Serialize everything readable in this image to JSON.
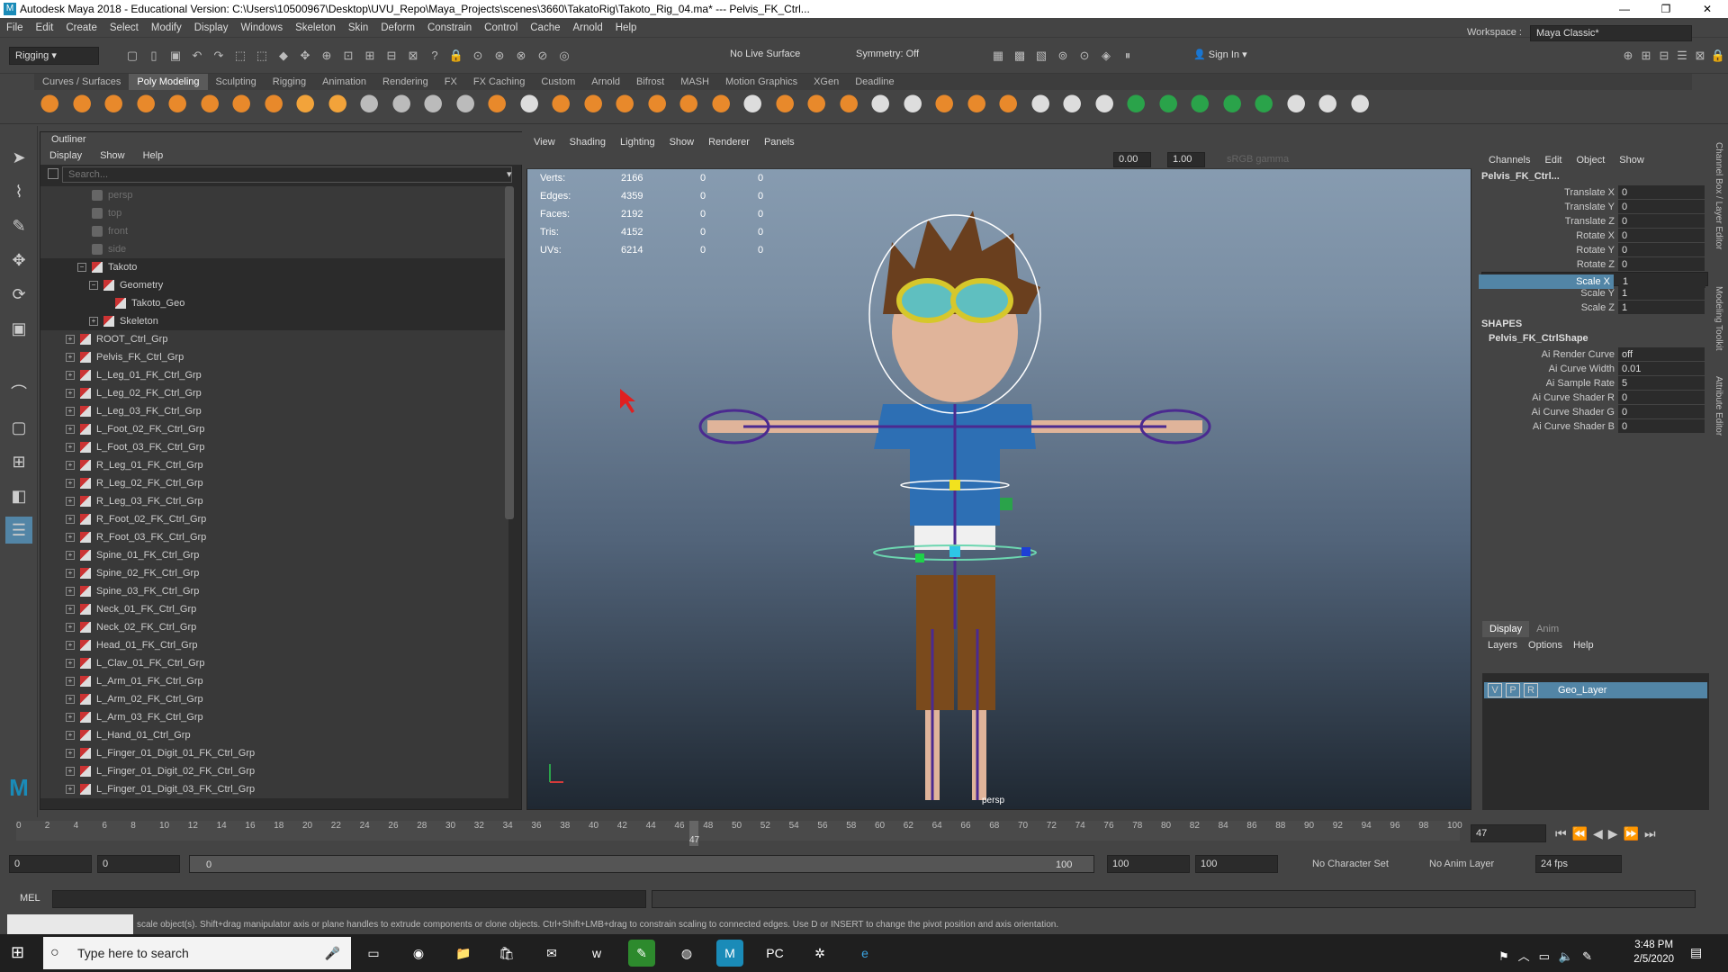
{
  "titlebar": {
    "title": "Autodesk Maya 2018 - Educational Version: C:\\Users\\10500967\\Desktop\\UVU_Repo\\Maya_Projects\\scenes\\3660\\TakatoRig\\Takoto_Rig_04.ma*   ---   Pelvis_FK_Ctrl..."
  },
  "menubar": [
    "File",
    "Edit",
    "Create",
    "Select",
    "Modify",
    "Display",
    "Windows",
    "Skeleton",
    "Skin",
    "Deform",
    "Constrain",
    "Control",
    "Cache",
    "Arnold",
    "Help"
  ],
  "toolbar": {
    "mode": "Rigging",
    "live_surface": "No Live Surface",
    "symmetry": "Symmetry: Off",
    "sign_in": "Sign In",
    "workspace_label": "Workspace :",
    "workspace": "Maya Classic*"
  },
  "shelf_tabs": [
    "Curves / Surfaces",
    "Poly Modeling",
    "Sculpting",
    "Rigging",
    "Animation",
    "Rendering",
    "FX",
    "FX Caching",
    "Custom",
    "Arnold",
    "Bifrost",
    "MASH",
    "Motion Graphics",
    "XGen",
    "Deadline"
  ],
  "outliner": {
    "title": "Outliner",
    "menu": [
      "Display",
      "Show",
      "Help"
    ],
    "search_placeholder": "Search...",
    "rows": [
      {
        "label": "persp",
        "indent": 1,
        "dim": true,
        "exp": ""
      },
      {
        "label": "top",
        "indent": 1,
        "dim": true,
        "exp": ""
      },
      {
        "label": "front",
        "indent": 1,
        "dim": true,
        "exp": ""
      },
      {
        "label": "side",
        "indent": 1,
        "dim": true,
        "exp": ""
      },
      {
        "label": "Takoto",
        "indent": 1,
        "dim": false,
        "exp": "−",
        "grp": true
      },
      {
        "label": "Geometry",
        "indent": 2,
        "dim": false,
        "exp": "−",
        "grp": true
      },
      {
        "label": "Takoto_Geo",
        "indent": 3,
        "dim": false,
        "exp": "",
        "grp": true
      },
      {
        "label": "Skeleton",
        "indent": 2,
        "dim": false,
        "exp": "+",
        "grp": true
      },
      {
        "label": "ROOT_Ctrl_Grp",
        "indent": 0,
        "exp": "+"
      },
      {
        "label": "Pelvis_FK_Ctrl_Grp",
        "indent": 0,
        "exp": "+"
      },
      {
        "label": "L_Leg_01_FK_Ctrl_Grp",
        "indent": 0,
        "exp": "+"
      },
      {
        "label": "L_Leg_02_FK_Ctrl_Grp",
        "indent": 0,
        "exp": "+"
      },
      {
        "label": "L_Leg_03_FK_Ctrl_Grp",
        "indent": 0,
        "exp": "+"
      },
      {
        "label": "L_Foot_02_FK_Ctrl_Grp",
        "indent": 0,
        "exp": "+"
      },
      {
        "label": "L_Foot_03_FK_Ctrl_Grp",
        "indent": 0,
        "exp": "+"
      },
      {
        "label": "R_Leg_01_FK_Ctrl_Grp",
        "indent": 0,
        "exp": "+"
      },
      {
        "label": "R_Leg_02_FK_Ctrl_Grp",
        "indent": 0,
        "exp": "+"
      },
      {
        "label": "R_Leg_03_FK_Ctrl_Grp",
        "indent": 0,
        "exp": "+"
      },
      {
        "label": "R_Foot_02_FK_Ctrl_Grp",
        "indent": 0,
        "exp": "+"
      },
      {
        "label": "R_Foot_03_FK_Ctrl_Grp",
        "indent": 0,
        "exp": "+"
      },
      {
        "label": "Spine_01_FK_Ctrl_Grp",
        "indent": 0,
        "exp": "+"
      },
      {
        "label": "Spine_02_FK_Ctrl_Grp",
        "indent": 0,
        "exp": "+"
      },
      {
        "label": "Spine_03_FK_Ctrl_Grp",
        "indent": 0,
        "exp": "+"
      },
      {
        "label": "Neck_01_FK_Ctrl_Grp",
        "indent": 0,
        "exp": "+"
      },
      {
        "label": "Neck_02_FK_Ctrl_Grp",
        "indent": 0,
        "exp": "+"
      },
      {
        "label": "Head_01_FK_Ctrl_Grp",
        "indent": 0,
        "exp": "+"
      },
      {
        "label": "L_Clav_01_FK_Ctrl_Grp",
        "indent": 0,
        "exp": "+"
      },
      {
        "label": "L_Arm_01_FK_Ctrl_Grp",
        "indent": 0,
        "exp": "+"
      },
      {
        "label": "L_Arm_02_FK_Ctrl_Grp",
        "indent": 0,
        "exp": "+"
      },
      {
        "label": "L_Arm_03_FK_Ctrl_Grp",
        "indent": 0,
        "exp": "+"
      },
      {
        "label": "L_Hand_01_Ctrl_Grp",
        "indent": 0,
        "exp": "+"
      },
      {
        "label": "L_Finger_01_Digit_01_FK_Ctrl_Grp",
        "indent": 0,
        "exp": "+"
      },
      {
        "label": "L_Finger_01_Digit_02_FK_Ctrl_Grp",
        "indent": 0,
        "exp": "+"
      },
      {
        "label": "L_Finger_01_Digit_03_FK_Ctrl_Grp",
        "indent": 0,
        "exp": "+"
      }
    ]
  },
  "viewport": {
    "menu": [
      "View",
      "Shading",
      "Lighting",
      "Show",
      "Renderer",
      "Panels"
    ],
    "field_a": "0.00",
    "field_b": "1.00",
    "colorspace": "sRGB gamma",
    "camera": "persp",
    "hud": [
      {
        "label": "Verts:",
        "a": "2166",
        "b": "0",
        "c": "0"
      },
      {
        "label": "Edges:",
        "a": "4359",
        "b": "0",
        "c": "0"
      },
      {
        "label": "Faces:",
        "a": "2192",
        "b": "0",
        "c": "0"
      },
      {
        "label": "Tris:",
        "a": "4152",
        "b": "0",
        "c": "0"
      },
      {
        "label": "UVs:",
        "a": "6214",
        "b": "0",
        "c": "0"
      }
    ]
  },
  "channelbox": {
    "menu": [
      "Channels",
      "Edit",
      "Object",
      "Show"
    ],
    "object": "Pelvis_FK_Ctrl...",
    "attrs": [
      {
        "name": "Translate X",
        "value": "0"
      },
      {
        "name": "Translate Y",
        "value": "0"
      },
      {
        "name": "Translate Z",
        "value": "0"
      },
      {
        "name": "Rotate X",
        "value": "0"
      },
      {
        "name": "Rotate Y",
        "value": "0"
      },
      {
        "name": "Rotate Z",
        "value": "0"
      },
      {
        "name": "Scale X",
        "value": "1",
        "selected": true
      },
      {
        "name": "Scale Y",
        "value": "1"
      },
      {
        "name": "Scale Z",
        "value": "1"
      }
    ],
    "shapes_label": "SHAPES",
    "shape_name": "Pelvis_FK_CtrlShape",
    "shape_attrs": [
      {
        "name": "Ai Render Curve",
        "value": "off"
      },
      {
        "name": "Ai Curve Width",
        "value": "0.01"
      },
      {
        "name": "Ai Sample Rate",
        "value": "5"
      },
      {
        "name": "Ai Curve Shader R",
        "value": "0"
      },
      {
        "name": "Ai Curve Shader G",
        "value": "0"
      },
      {
        "name": "Ai Curve Shader B",
        "value": "0"
      }
    ],
    "side_tabs": [
      "Channel Box / Layer Editor",
      "Modeling Toolkit",
      "Attribute Editor"
    ]
  },
  "layers": {
    "tabs": [
      "Display",
      "Anim"
    ],
    "menu": [
      "Layers",
      "Options",
      "Help"
    ],
    "layer": {
      "v": "V",
      "p": "P",
      "r": "R",
      "name": "Geo_Layer"
    }
  },
  "timeline": {
    "ticks": [
      "0",
      "2",
      "4",
      "6",
      "8",
      "10",
      "12",
      "14",
      "16",
      "18",
      "20",
      "22",
      "24",
      "26",
      "28",
      "30",
      "32",
      "34",
      "36",
      "38",
      "40",
      "42",
      "44",
      "46",
      "48",
      "50",
      "52",
      "54",
      "56",
      "58",
      "60",
      "62",
      "64",
      "66",
      "68",
      "70",
      "72",
      "74",
      "76",
      "78",
      "80",
      "82",
      "84",
      "86",
      "88",
      "90",
      "92",
      "94",
      "96",
      "98",
      "100"
    ],
    "current": "47",
    "current_field": "47"
  },
  "range": {
    "start": "0",
    "start2": "0",
    "slider_left": "0",
    "slider_right": "100",
    "end": "100",
    "end2": "100",
    "character": "No Character Set",
    "anim_layer": "No Anim Layer",
    "fps": "24 fps"
  },
  "cmdline": {
    "label": "MEL"
  },
  "helpline": {
    "text": "scale object(s). Shift+drag manipulator axis or plane handles to extrude components or clone objects. Ctrl+Shift+LMB+drag to constrain scaling to connected edges. Use D or INSERT to change the pivot position and axis orientation."
  },
  "taskbar": {
    "search": "Type here to search",
    "time": "3:48 PM",
    "date": "2/5/2020"
  }
}
